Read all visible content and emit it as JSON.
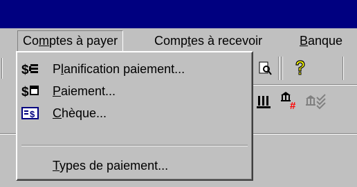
{
  "menubar": {
    "items": [
      {
        "label": "Comptes à payer"
      },
      {
        "label": "Comptes à recevoir"
      },
      {
        "label": "Banque"
      }
    ]
  },
  "dropdown": {
    "items": [
      {
        "label": "Planification paiement...",
        "icon": "dollar-schedule-icon"
      },
      {
        "label": "Paiement...",
        "icon": "dollar-payment-icon"
      },
      {
        "label": "Chèque...",
        "icon": "check-icon"
      },
      {
        "label": "Types de paiement...",
        "icon": ""
      }
    ]
  },
  "toolbar": {
    "icons": [
      "print-preview-icon",
      "help-icon",
      "bank-transfer-icon",
      "bank-number-icon",
      "bank-reconcile-icon"
    ]
  },
  "colors": {
    "titlebar": "#000080",
    "face": "#c0c0c0",
    "help_icon_yellow": "#ffff00",
    "bank_icon_red": "#ff0000"
  }
}
